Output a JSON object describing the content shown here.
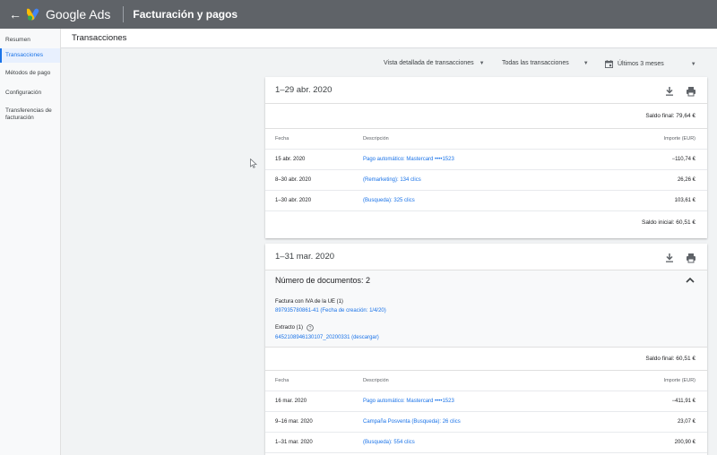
{
  "topbar": {
    "back_glyph": "←",
    "product_name": "Google Ads",
    "page_title": "Facturación y pagos",
    "logo_colors": {
      "yellow": "#fbbc04",
      "blue": "#4285f4",
      "green": "#34a853"
    }
  },
  "sidebar": {
    "items": [
      {
        "label": "Resumen",
        "active": false
      },
      {
        "label": "Transacciones",
        "active": true
      },
      {
        "label": "Métodos de pago",
        "active": false
      },
      {
        "label": "Configuración",
        "active": false
      },
      {
        "label": "Transferencias de facturación",
        "active": false
      }
    ]
  },
  "header": {
    "title": "Transacciones"
  },
  "filters": {
    "view": "Vista detallada de transacciones",
    "transactions": "Todas las transacciones",
    "date_range": "Últimos 3 meses"
  },
  "columns": {
    "date": "Fecha",
    "description": "Descripción",
    "amount": "Importe (EUR)"
  },
  "period1": {
    "title": "1–29 abr. 2020",
    "final_balance": "Saldo final: 79,64 €",
    "initial_balance": "Saldo inicial: 60,51 €",
    "rows": [
      {
        "date": "15 abr. 2020",
        "description": "Pago automático: Mastercard ••••1523",
        "amount": "−110,74 €"
      },
      {
        "date": "8–30 abr. 2020",
        "description": "(Remarketing): 134 clics",
        "amount": "26,26 €"
      },
      {
        "date": "1–30 abr. 2020",
        "description": "(Busqueda): 325 clics",
        "amount": "103,61 €"
      }
    ]
  },
  "period2": {
    "title": "1–31 mar. 2020",
    "docs_title": "Número de documentos: 2",
    "doc1_label": "Factura con IVA de la UE (1)",
    "doc1_link": "897935780861-41 (Fecha de creación: 1/4/20)",
    "doc2_label": "Extracto (1)",
    "doc2_link": "6452108946130107_20200331 (descargar)",
    "final_balance": "Saldo final: 60,51 €",
    "rows": [
      {
        "date": "16 mar. 2020",
        "description": "Pago automático: Mastercard ••••1523",
        "amount": "−411,91 €"
      },
      {
        "date": "9–16 mar. 2020",
        "description": "Campaña Posventa (Busqueda): 26 clics",
        "amount": "23,07 €"
      },
      {
        "date": "1–31 mar. 2020",
        "description": "(Busqueda): 554 clics",
        "amount": "200,90 €"
      }
    ]
  },
  "icons": [
    "back-arrow-icon",
    "google-ads-logo-icon",
    "calendar-icon",
    "download-icon",
    "print-icon",
    "chevron-up-icon",
    "help-icon",
    "mouse-cursor-icon"
  ]
}
